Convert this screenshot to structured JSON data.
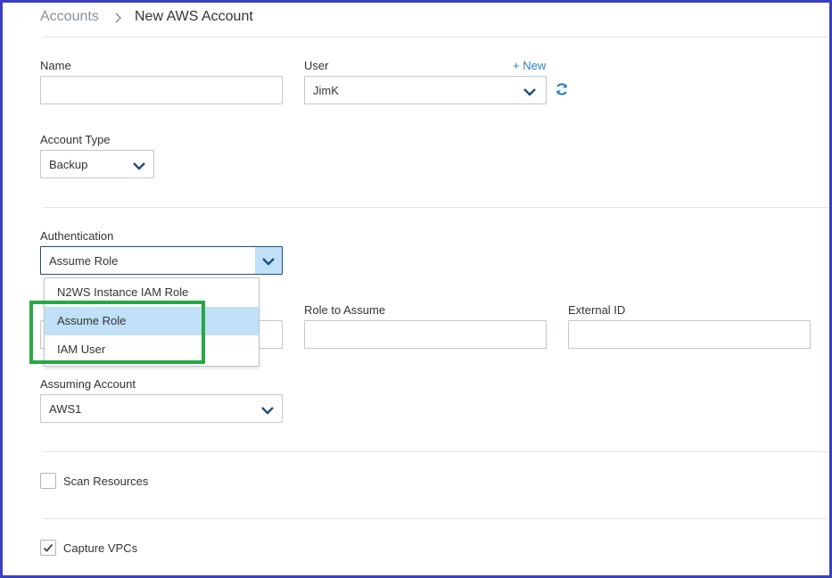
{
  "breadcrumb": {
    "parent": "Accounts",
    "separator": ">",
    "current": "New AWS Account"
  },
  "name": {
    "label": "Name",
    "value": ""
  },
  "user": {
    "label": "User",
    "new_link": "+ New",
    "value": "JimK"
  },
  "account_type": {
    "label": "Account Type",
    "value": "Backup"
  },
  "authentication": {
    "label": "Authentication",
    "value": "Assume Role",
    "options": [
      "N2WS Instance IAM Role",
      "Assume Role",
      "IAM User"
    ],
    "selected_index": 1
  },
  "role_to_assume": {
    "label": "Role to Assume",
    "value": ""
  },
  "external_id": {
    "label": "External ID",
    "value": ""
  },
  "assuming_account": {
    "label": "Assuming Account",
    "value": "AWS1"
  },
  "scan_resources": {
    "label": "Scan Resources",
    "checked": false
  },
  "capture_vpcs": {
    "label": "Capture VPCs",
    "checked": true
  },
  "colors": {
    "frame": "#3a3fbf",
    "highlight": "#27a844",
    "accent": "#2f7fc1",
    "selected_option": "#bfe0f7"
  }
}
